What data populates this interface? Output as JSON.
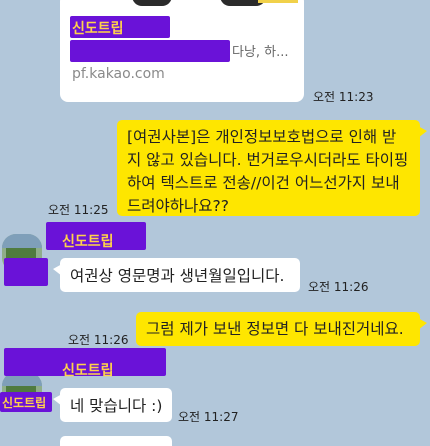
{
  "link_card": {
    "title": "신도트립",
    "description_visible": "다낭, 하...",
    "url": "pf.kakao.com",
    "time": "오전 11:23"
  },
  "messages": [
    {
      "sender": "me",
      "text": "[여권사본]은 개인정보보호법으로 인해 받지 않고 있습니다. 번거로우시더라도 타이핑 하여 텍스트로 전송//이건 어느선가지 보내드려야하나요??",
      "time": "오전 11:25"
    },
    {
      "sender": "other",
      "sender_name": "신도트립",
      "text": "여권상 영문명과 생년월일입니다.",
      "time": "오전 11:26"
    },
    {
      "sender": "me",
      "text": "그럼 제가 보낸 정보면 다 보내진거네요.",
      "time": "오전 11:26"
    },
    {
      "sender": "other",
      "sender_name": "신도트립",
      "avatar_label": "신도트립",
      "text": "네 맞습니다 :)",
      "time": "오전 11:27"
    }
  ],
  "colors": {
    "background": "#b2c7da",
    "my_bubble": "#fee600",
    "other_bubble": "#ffffff",
    "redaction": "#6a12d8"
  }
}
